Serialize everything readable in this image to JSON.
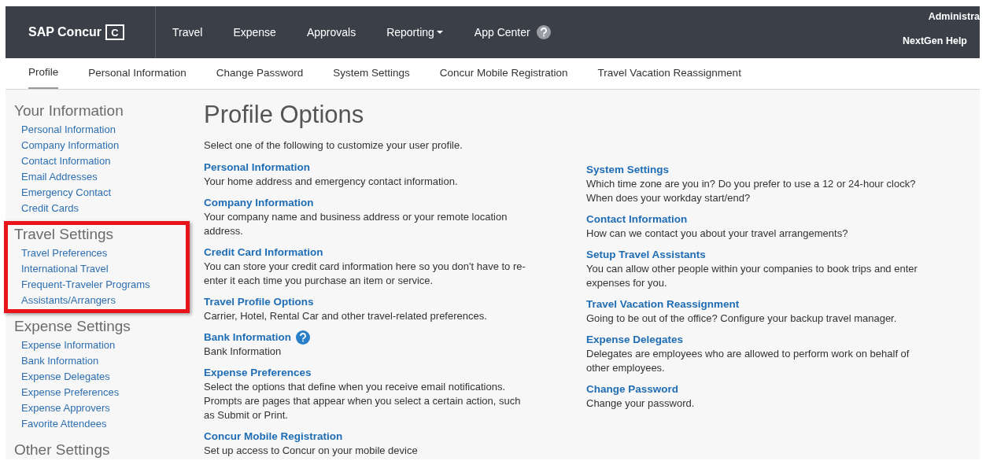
{
  "topbar": {
    "logo": "SAP Concur",
    "logo_mark": "C",
    "nav": [
      {
        "label": "Travel",
        "dropdown": false,
        "help": false
      },
      {
        "label": "Expense",
        "dropdown": false,
        "help": false
      },
      {
        "label": "Approvals",
        "dropdown": false,
        "help": false
      },
      {
        "label": "Reporting",
        "dropdown": true,
        "help": false
      },
      {
        "label": "App Center",
        "dropdown": false,
        "help": true
      }
    ],
    "user": "Administra",
    "help_link": "NextGen Help"
  },
  "tabs": [
    {
      "label": "Profile",
      "selected": true
    },
    {
      "label": "Personal Information",
      "selected": false
    },
    {
      "label": "Change Password",
      "selected": false
    },
    {
      "label": "System Settings",
      "selected": false
    },
    {
      "label": "Concur Mobile Registration",
      "selected": false
    },
    {
      "label": "Travel Vacation Reassignment",
      "selected": false
    }
  ],
  "sidebar": {
    "sections": [
      {
        "title": "Your Information",
        "highlighted": false,
        "items": [
          "Personal Information",
          "Company Information",
          "Contact Information",
          "Email Addresses",
          "Emergency Contact",
          "Credit Cards"
        ]
      },
      {
        "title": "Travel Settings",
        "highlighted": true,
        "items": [
          "Travel Preferences",
          "International Travel",
          "Frequent-Traveler Programs",
          "Assistants/Arrangers"
        ]
      },
      {
        "title": "Expense Settings",
        "highlighted": false,
        "items": [
          "Expense Information",
          "Bank Information",
          "Expense Delegates",
          "Expense Preferences",
          "Expense Approvers",
          "Favorite Attendees"
        ]
      },
      {
        "title": "Other Settings",
        "highlighted": false
      }
    ]
  },
  "main": {
    "title": "Profile Options",
    "intro": "Select one of the following to customize your user profile.",
    "columns": [
      [
        {
          "title": "Personal Information",
          "help": false,
          "description": "Your home address and emergency contact information."
        },
        {
          "title": "Company Information",
          "help": false,
          "description": "Your company name and business address or your remote location address."
        },
        {
          "title": "Credit Card Information",
          "help": false,
          "description": "You can store your credit card information here so you don't have to re-enter it each time you purchase an item or service."
        },
        {
          "title": "Travel Profile Options",
          "help": false,
          "description": "Carrier, Hotel, Rental Car and other travel-related preferences."
        },
        {
          "title": "Bank Information",
          "help": true,
          "description": "Bank Information"
        },
        {
          "title": "Expense Preferences",
          "help": false,
          "description": "Select the options that define when you receive email notifications. Prompts are pages that appear when you select a certain action, such as Submit or Print."
        },
        {
          "title": "Concur Mobile Registration",
          "help": false,
          "description": "Set up access to Concur on your mobile device"
        }
      ],
      [
        {
          "title": "System Settings",
          "help": false,
          "description": "Which time zone are you in? Do you prefer to use a 12 or 24-hour clock? When does your workday start/end?"
        },
        {
          "title": "Contact Information",
          "help": false,
          "description": "How can we contact you about your travel arrangements?"
        },
        {
          "title": "Setup Travel Assistants",
          "help": false,
          "description": "You can allow other people within your companies to book trips and enter expenses for you."
        },
        {
          "title": "Travel Vacation Reassignment",
          "help": false,
          "description": "Going to be out of the office? Configure your backup travel manager."
        },
        {
          "title": "Expense Delegates",
          "help": false,
          "description": "Delegates are employees who are allowed to perform work on behalf of other employees."
        },
        {
          "title": "Change Password",
          "help": false,
          "description": "Change your password."
        }
      ]
    ]
  }
}
